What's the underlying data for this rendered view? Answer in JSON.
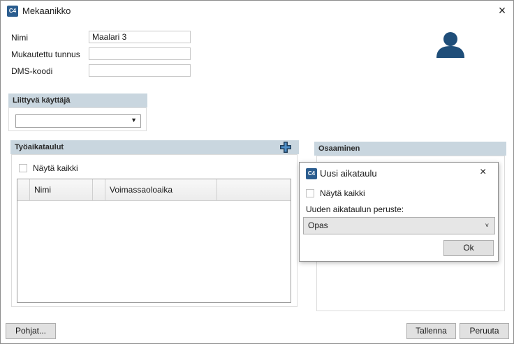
{
  "window": {
    "title": "Mekaanikko",
    "app_icon": "c4-app-icon",
    "close": "×"
  },
  "form": {
    "name_label": "Nimi",
    "name_value": "Maalari 3",
    "custom_id_label": "Mukautettu tunnus",
    "custom_id_value": "",
    "dms_label": "DMS-koodi",
    "dms_value": ""
  },
  "linked_user": {
    "title": "Liittyvä käyttäjä",
    "value": ""
  },
  "schedules": {
    "title": "Työaikataulut",
    "show_all_label": "Näytä kaikki",
    "columns": [
      "Nimi",
      "Voimassaoloaika"
    ],
    "rows": []
  },
  "skills": {
    "title": "Osaaminen"
  },
  "dialog": {
    "title": "Uusi aikataulu",
    "close": "×",
    "show_all_label": "Näytä kaikki",
    "basis_label": "Uuden aikataulun peruste:",
    "basis_value": "Opas",
    "ok_label": "Ok"
  },
  "footer": {
    "templates_label": "Pohjat...",
    "save_label": "Tallenna",
    "cancel_label": "Peruuta"
  },
  "colors": {
    "panel_header": "#c9d6df",
    "accent": "#1f4e79"
  }
}
